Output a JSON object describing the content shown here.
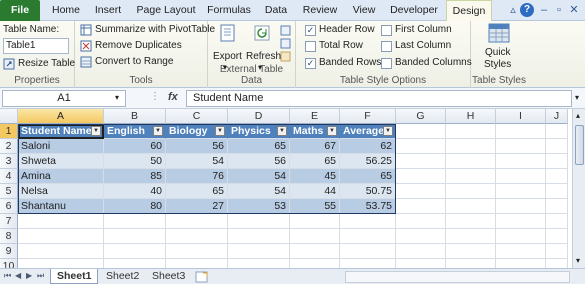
{
  "ribbon_tabs": [
    {
      "label": "File",
      "name": "tab-file"
    },
    {
      "label": "Home",
      "name": "tab-home"
    },
    {
      "label": "Insert",
      "name": "tab-insert"
    },
    {
      "label": "Page Layout",
      "name": "tab-page-layout"
    },
    {
      "label": "Formulas",
      "name": "tab-formulas"
    },
    {
      "label": "Data",
      "name": "tab-data"
    },
    {
      "label": "Review",
      "name": "tab-review"
    },
    {
      "label": "View",
      "name": "tab-view"
    },
    {
      "label": "Developer",
      "name": "tab-developer"
    },
    {
      "label": "Design",
      "name": "tab-design"
    }
  ],
  "properties": {
    "table_name_label": "Table Name:",
    "table_name_value": "Table1",
    "resize_label": "Resize Table",
    "group_label": "Properties"
  },
  "tools": {
    "summarize_label": "Summarize with PivotTable",
    "remove_dup_label": "Remove Duplicates",
    "convert_label": "Convert to Range",
    "group_label": "Tools"
  },
  "external": {
    "export_label": "Export",
    "refresh_label": "Refresh",
    "group_label": "External Table Data"
  },
  "style_options": {
    "header_row": {
      "label": "Header Row",
      "checked": true
    },
    "total_row": {
      "label": "Total Row",
      "checked": false
    },
    "banded_rows": {
      "label": "Banded Rows",
      "checked": true
    },
    "first_column": {
      "label": "First Column",
      "checked": false
    },
    "last_column": {
      "label": "Last Column",
      "checked": false
    },
    "banded_columns": {
      "label": "Banded Columns",
      "checked": false
    },
    "group_label": "Table Style Options",
    "check_mark": "✓"
  },
  "table_styles": {
    "quick_line1": "Quick",
    "quick_line2": "Styles",
    "group_label": "Table Styles"
  },
  "formula_bar": {
    "name_box": "A1",
    "fx": "fx",
    "formula": "Student Name"
  },
  "grid": {
    "columns": [
      "A",
      "B",
      "C",
      "D",
      "E",
      "F",
      "G",
      "H",
      "I",
      "J"
    ],
    "rows": [
      "1",
      "2",
      "3",
      "4",
      "5",
      "6",
      "7",
      "8",
      "9",
      "10"
    ],
    "table_headers": [
      "Student Name",
      "English",
      "Biology",
      "Physics",
      "Maths",
      "Average"
    ],
    "table_rows": [
      [
        "Saloni",
        "60",
        "56",
        "65",
        "67",
        "62"
      ],
      [
        "Shweta",
        "50",
        "54",
        "56",
        "65",
        "56.25"
      ],
      [
        "Amina",
        "85",
        "76",
        "54",
        "45",
        "65"
      ],
      [
        "Nelsa",
        "40",
        "65",
        "54",
        "44",
        "50.75"
      ],
      [
        "Shantanu",
        "80",
        "27",
        "53",
        "55",
        "53.75"
      ]
    ],
    "filter_glyph": "▼"
  },
  "sheets": {
    "tabs": [
      "Sheet1",
      "Sheet2",
      "Sheet3"
    ],
    "active": "Sheet1"
  },
  "colors": {
    "header_fill": "#4f81bd",
    "band_fill": "#b8cce4",
    "plain_fill": "#dce6f1",
    "file_tab": "#2a7a2f"
  }
}
